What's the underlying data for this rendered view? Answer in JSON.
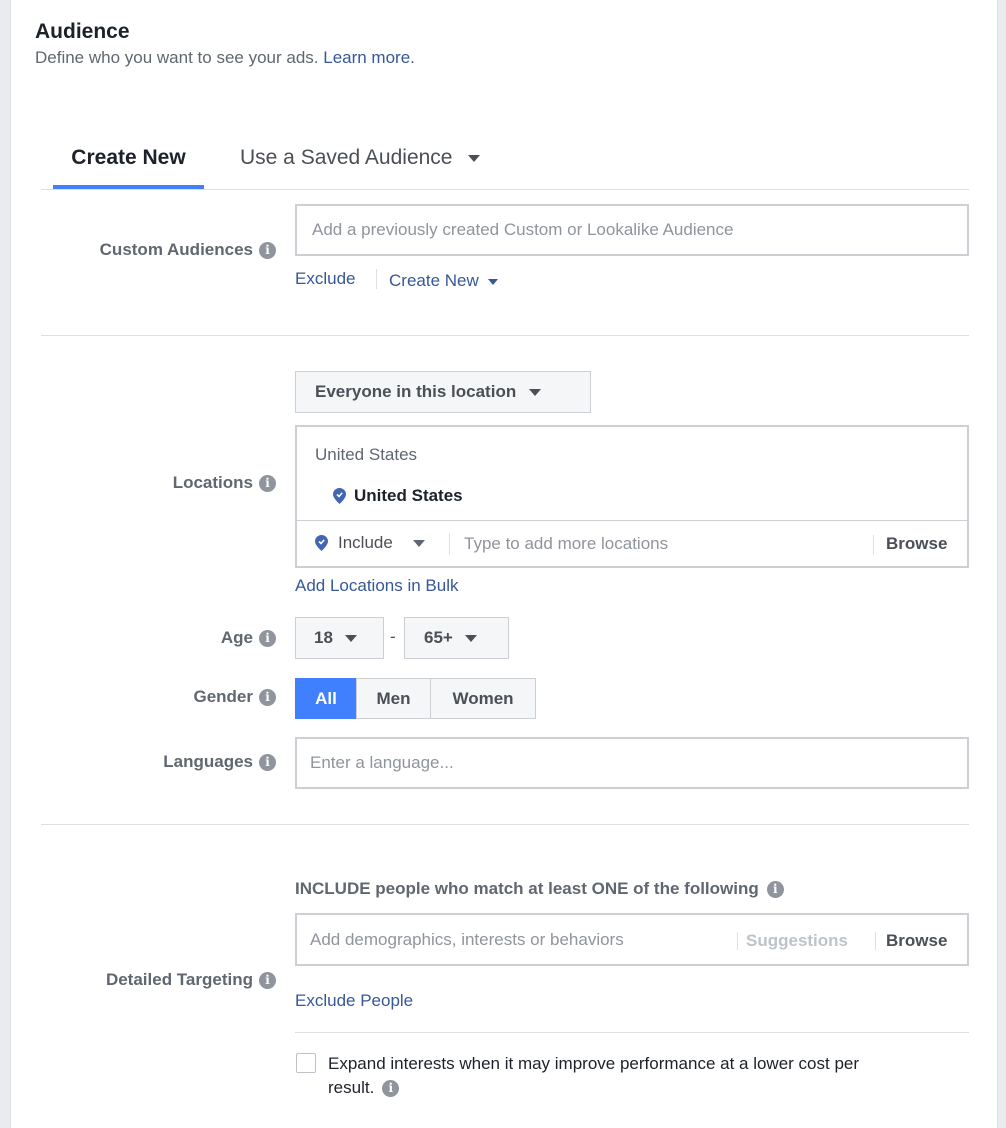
{
  "header": {
    "title": "Audience",
    "subtitle": "Define who you want to see your ads.",
    "learn_more": "Learn more."
  },
  "tabs": [
    {
      "label": "Create New",
      "active": true
    },
    {
      "label": "Use a Saved Audience",
      "active": false
    }
  ],
  "custom_audiences": {
    "label": "Custom Audiences",
    "placeholder": "Add a previously created Custom or Lookalike Audience",
    "exclude": "Exclude",
    "create_new": "Create New"
  },
  "locations": {
    "label": "Locations",
    "scope_dropdown": "Everyone in this location",
    "group_heading": "United States",
    "selected": "United States",
    "include_dropdown": "Include",
    "placeholder": "Type to add more locations",
    "browse": "Browse",
    "bulk_link": "Add Locations in Bulk"
  },
  "age": {
    "label": "Age",
    "min": "18",
    "separator": "-",
    "max": "65+"
  },
  "gender": {
    "label": "Gender",
    "options": [
      "All",
      "Men",
      "Women"
    ],
    "selected": "All"
  },
  "languages": {
    "label": "Languages",
    "placeholder": "Enter a language..."
  },
  "detailed_targeting": {
    "label": "Detailed Targeting",
    "include_heading": "INCLUDE people who match at least ONE of the following",
    "placeholder": "Add demographics, interests or behaviors",
    "suggestions": "Suggestions",
    "browse": "Browse",
    "exclude_link": "Exclude People",
    "expand_checkbox_line1": "Expand interests when it may improve performance at a lower cost per",
    "expand_checkbox_line2": "result.",
    "expand_checked": false
  },
  "colors": {
    "accent": "#4080ff",
    "link": "#365899",
    "label": "#606770"
  },
  "icons": {
    "info": "info-icon",
    "caret": "caret-down-icon",
    "pin": "location-pin-icon"
  }
}
